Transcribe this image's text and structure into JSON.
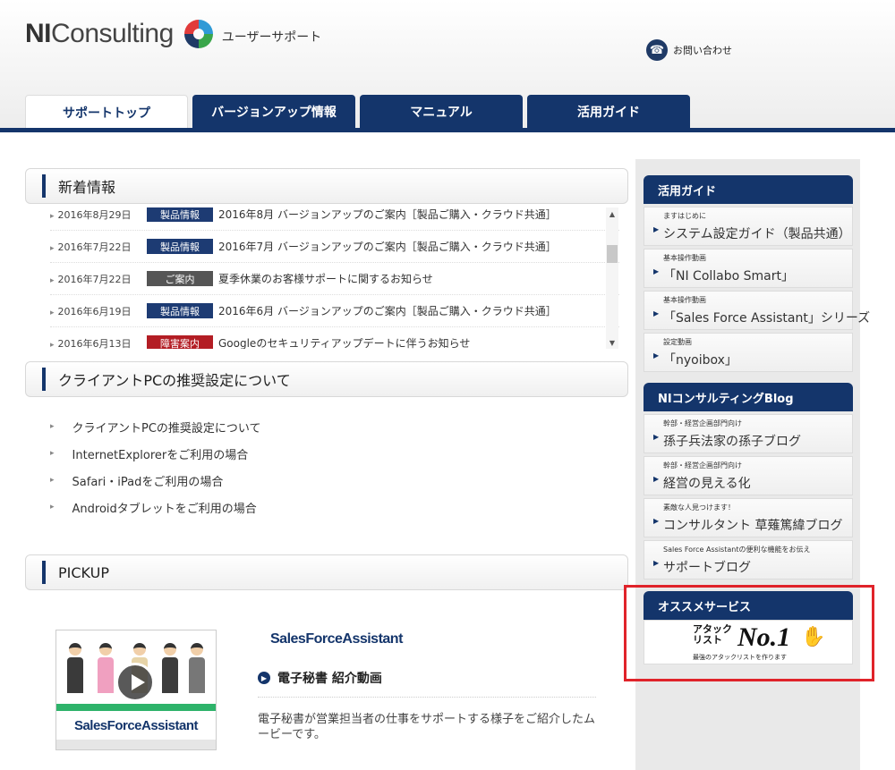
{
  "header": {
    "logo_ni": "NI",
    "logo_consulting": "Consulting",
    "subtitle": "ユーザーサポート",
    "contact_label": "お問い合わせ"
  },
  "tabs": [
    {
      "label": "サポートトップ",
      "active": true
    },
    {
      "label": "バージョンアップ情報",
      "active": false
    },
    {
      "label": "マニュアル",
      "active": false
    },
    {
      "label": "活用ガイド",
      "active": false
    }
  ],
  "news": {
    "title": "新着情報",
    "items": [
      {
        "date": "2016年8月29日",
        "badge": "製品情報",
        "badge_color": "#1d3b73",
        "title": "2016年8月 バージョンアップのご案内［製品ご購入・クラウド共通］"
      },
      {
        "date": "2016年7月22日",
        "badge": "製品情報",
        "badge_color": "#1d3b73",
        "title": "2016年7月 バージョンアップのご案内［製品ご購入・クラウド共通］"
      },
      {
        "date": "2016年7月22日",
        "badge": "ご案内",
        "badge_color": "#555555",
        "title": "夏季休業のお客様サポートに関するお知らせ"
      },
      {
        "date": "2016年6月19日",
        "badge": "製品情報",
        "badge_color": "#1d3b73",
        "title": "2016年6月 バージョンアップのご案内［製品ご購入・クラウド共通］"
      },
      {
        "date": "2016年6月13日",
        "badge": "障害案内",
        "badge_color": "#b31d24",
        "title": "Googleのセキュリティアップデートに伴うお知らせ"
      }
    ]
  },
  "client": {
    "title": "クライアントPCの推奨設定について",
    "items": [
      "クライアントPCの推奨設定について",
      "InternetExplorerをご利用の場合",
      "Safari・iPadをご利用の場合",
      "Androidタブレットをご利用の場合"
    ]
  },
  "pickup": {
    "title": "PICKUP",
    "thumb_brand": "SalesForceAssistant",
    "brand": "SalesForceAssistant",
    "heading": "電子秘書 紹介動画",
    "description": "電子秘書が営業担当者の仕事をサポートする様子をご紹介したムービーです。"
  },
  "sidebar": {
    "guide": {
      "title": "活用ガイド",
      "items": [
        {
          "small": "ますはじめに",
          "large": "システム設定ガイド（製品共通）"
        },
        {
          "small": "基本操作動画",
          "large": "「NI Collabo Smart」"
        },
        {
          "small": "基本操作動画",
          "large": "「Sales Force Assistant」シリーズ"
        },
        {
          "small": "設定動画",
          "large": "「nyoibox」"
        }
      ]
    },
    "blog": {
      "title": "NIコンサルティングBlog",
      "items": [
        {
          "small": "幹部・経営企画部門向け",
          "large": "孫子兵法家の孫子ブログ"
        },
        {
          "small": "幹部・経営企画部門向け",
          "large": "経営の見える化"
        },
        {
          "small": "素敵な人見つけます！",
          "large": "コンサルタント 草薙篤緯ブログ"
        },
        {
          "small": "Sales Force Assistantの便利な機能をお伝え",
          "large": "サポートブログ"
        }
      ]
    },
    "recommend": {
      "title": "オススメサービス",
      "promo_kana": "アタック\nリスト",
      "promo_main": "No.1",
      "promo_sub": "最強のアタックリストを作ります"
    }
  }
}
